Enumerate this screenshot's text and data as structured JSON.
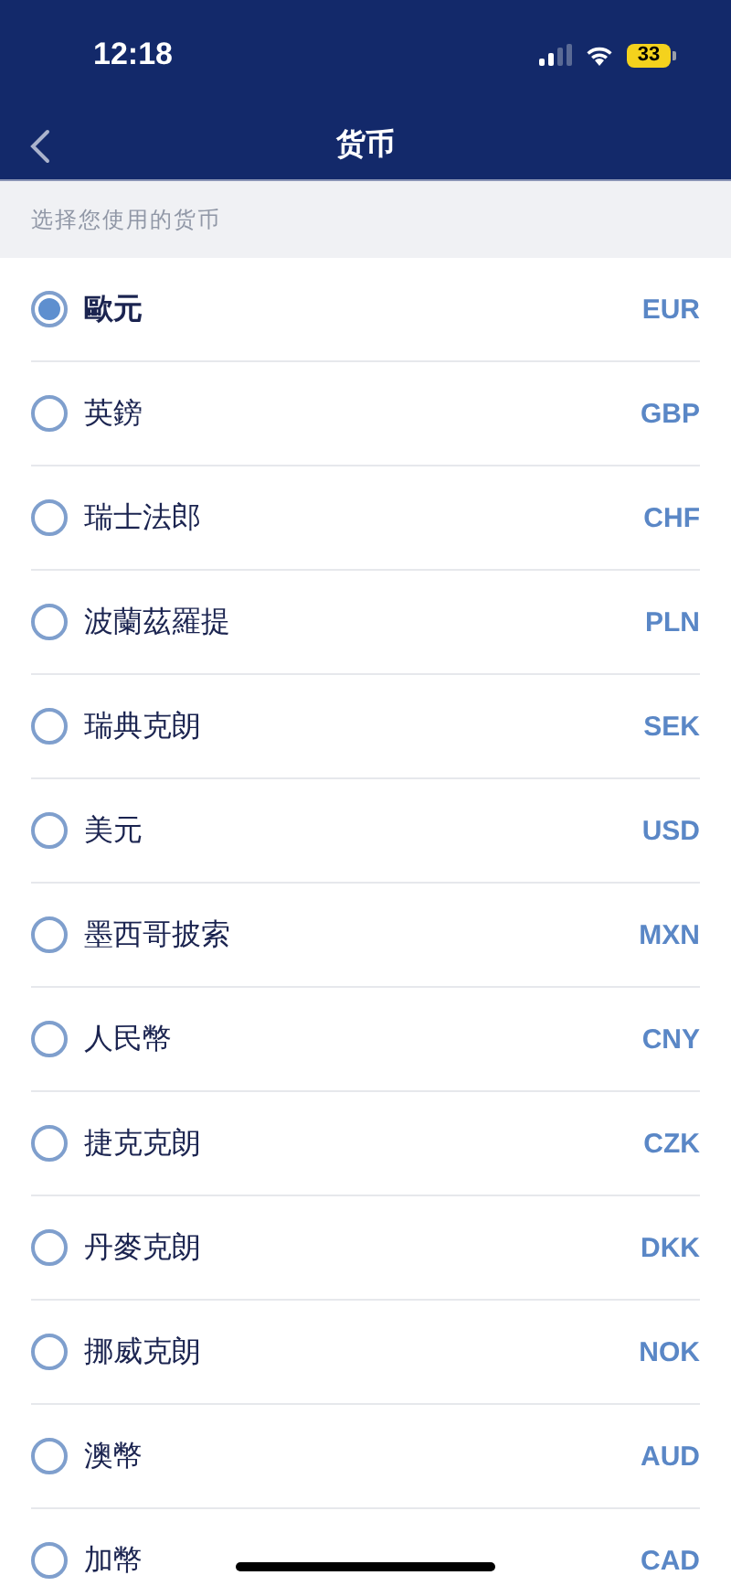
{
  "status_bar": {
    "time": "12:18",
    "battery": "33"
  },
  "nav": {
    "title": "货币"
  },
  "section_header": "选择您使用的货币",
  "currencies": [
    {
      "name": "歐元",
      "code": "EUR",
      "selected": true
    },
    {
      "name": "英鎊",
      "code": "GBP",
      "selected": false
    },
    {
      "name": "瑞士法郎",
      "code": "CHF",
      "selected": false
    },
    {
      "name": "波蘭茲羅提",
      "code": "PLN",
      "selected": false
    },
    {
      "name": "瑞典克朗",
      "code": "SEK",
      "selected": false
    },
    {
      "name": "美元",
      "code": "USD",
      "selected": false
    },
    {
      "name": "墨西哥披索",
      "code": "MXN",
      "selected": false
    },
    {
      "name": "人民幣",
      "code": "CNY",
      "selected": false
    },
    {
      "name": "捷克克朗",
      "code": "CZK",
      "selected": false
    },
    {
      "name": "丹麥克朗",
      "code": "DKK",
      "selected": false
    },
    {
      "name": "挪威克朗",
      "code": "NOK",
      "selected": false
    },
    {
      "name": "澳幣",
      "code": "AUD",
      "selected": false
    },
    {
      "name": "加幣",
      "code": "CAD",
      "selected": false
    }
  ]
}
